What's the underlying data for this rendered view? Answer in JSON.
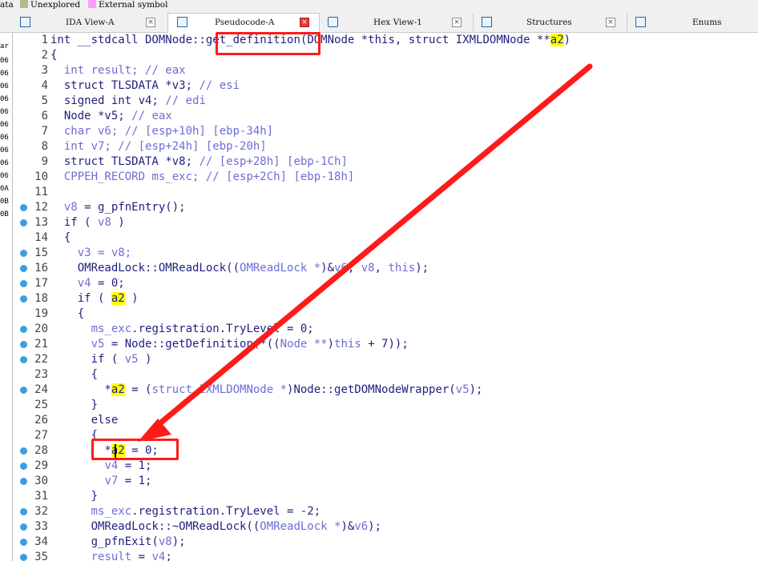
{
  "legend": [
    {
      "label": "ata",
      "color": ""
    },
    {
      "label": "Unexplored",
      "color": "#b7b78a"
    },
    {
      "label": "External symbol",
      "color": "#ff9cff"
    }
  ],
  "tabs": [
    {
      "label": "IDA View-A",
      "icon": "ida-view-icon",
      "active": false
    },
    {
      "label": "Pseudocode-A",
      "icon": "pseudocode-icon",
      "active": true
    },
    {
      "label": "Hex View-1",
      "icon": "hex-view-icon",
      "active": false
    },
    {
      "label": "Structures",
      "icon": "structures-icon",
      "active": false
    },
    {
      "label": "Enums",
      "icon": "enums-icon",
      "active": false
    }
  ],
  "left_panel": [
    "ar",
    "06",
    "06",
    "06",
    "06",
    "06",
    "06",
    "06",
    "06",
    "06",
    "06",
    "0A",
    "0B",
    "0B"
  ],
  "code_lines": [
    {
      "n": "1",
      "dot": false,
      "tokens": [
        [
          "k",
          "int __stdcall DOMNode::"
        ],
        [
          "i",
          "get_definition"
        ],
        [
          "k",
          "(DOMNode *this, struct IXMLDOMNode **"
        ],
        [
          "h",
          "a2"
        ],
        [
          "k",
          ")"
        ]
      ]
    },
    {
      "n": "2",
      "dot": false,
      "tokens": [
        [
          "k",
          "{"
        ]
      ]
    },
    {
      "n": "3",
      "dot": false,
      "tokens": [
        [
          "k",
          "  "
        ],
        [
          "v",
          "int result; // eax"
        ]
      ]
    },
    {
      "n": "4",
      "dot": false,
      "tokens": [
        [
          "k",
          "  struct TLSDATA *v3; "
        ],
        [
          "c",
          "// esi"
        ]
      ]
    },
    {
      "n": "5",
      "dot": false,
      "tokens": [
        [
          "k",
          "  signed int v4; "
        ],
        [
          "c",
          "// edi"
        ]
      ]
    },
    {
      "n": "6",
      "dot": false,
      "tokens": [
        [
          "k",
          "  Node *v5; "
        ],
        [
          "c",
          "// eax"
        ]
      ]
    },
    {
      "n": "7",
      "dot": false,
      "tokens": [
        [
          "k",
          "  "
        ],
        [
          "v",
          "char v6; "
        ],
        [
          "c",
          "// [esp+10h] [ebp-34h]"
        ]
      ]
    },
    {
      "n": "8",
      "dot": false,
      "tokens": [
        [
          "k",
          "  "
        ],
        [
          "v",
          "int v7; "
        ],
        [
          "c",
          "// [esp+24h] [ebp-20h]"
        ]
      ]
    },
    {
      "n": "9",
      "dot": false,
      "tokens": [
        [
          "k",
          "  struct TLSDATA *v8; "
        ],
        [
          "c",
          "// [esp+28h] [ebp-1Ch]"
        ]
      ]
    },
    {
      "n": "10",
      "dot": false,
      "tokens": [
        [
          "k",
          "  "
        ],
        [
          "v",
          "CPPEH_RECORD ms_exc; "
        ],
        [
          "c",
          "// [esp+2Ch] [ebp-18h]"
        ]
      ]
    },
    {
      "n": "11",
      "dot": false,
      "tokens": []
    },
    {
      "n": "12",
      "dot": true,
      "tokens": [
        [
          "k",
          "  "
        ],
        [
          "v",
          "v8"
        ],
        [
          "k",
          " = g_pfnEntry();"
        ]
      ]
    },
    {
      "n": "13",
      "dot": true,
      "tokens": [
        [
          "k",
          "  if ( "
        ],
        [
          "v",
          "v8"
        ],
        [
          "k",
          " )"
        ]
      ]
    },
    {
      "n": "14",
      "dot": false,
      "tokens": [
        [
          "k",
          "  {"
        ]
      ]
    },
    {
      "n": "15",
      "dot": true,
      "tokens": [
        [
          "k",
          "    "
        ],
        [
          "v",
          "v3 = v8;"
        ]
      ]
    },
    {
      "n": "16",
      "dot": true,
      "tokens": [
        [
          "k",
          "    OMReadLock::OMReadLock(("
        ],
        [
          "v",
          "OMReadLock *"
        ],
        [
          "k",
          ")&"
        ],
        [
          "v",
          "v6"
        ],
        [
          "k",
          ", "
        ],
        [
          "v",
          "v8"
        ],
        [
          "k",
          ", "
        ],
        [
          "v",
          "this"
        ],
        [
          "k",
          ");"
        ]
      ]
    },
    {
      "n": "17",
      "dot": true,
      "tokens": [
        [
          "k",
          "    "
        ],
        [
          "v",
          "v4"
        ],
        [
          "k",
          " = 0;"
        ]
      ]
    },
    {
      "n": "18",
      "dot": true,
      "tokens": [
        [
          "k",
          "    if ( "
        ],
        [
          "h",
          "a2"
        ],
        [
          "k",
          " )"
        ]
      ]
    },
    {
      "n": "19",
      "dot": false,
      "tokens": [
        [
          "k",
          "    {"
        ]
      ]
    },
    {
      "n": "20",
      "dot": true,
      "tokens": [
        [
          "k",
          "      "
        ],
        [
          "v",
          "ms_exc"
        ],
        [
          "k",
          ".registration.TryLevel = 0;"
        ]
      ]
    },
    {
      "n": "21",
      "dot": true,
      "tokens": [
        [
          "k",
          "      "
        ],
        [
          "v",
          "v5"
        ],
        [
          "k",
          " = Node::getDefinition(*(("
        ],
        [
          "v",
          "Node **"
        ],
        [
          "k",
          ")"
        ],
        [
          "v",
          "this"
        ],
        [
          "k",
          " + 7));"
        ]
      ]
    },
    {
      "n": "22",
      "dot": true,
      "tokens": [
        [
          "k",
          "      if ( "
        ],
        [
          "v",
          "v5"
        ],
        [
          "k",
          " )"
        ]
      ]
    },
    {
      "n": "23",
      "dot": false,
      "tokens": [
        [
          "k",
          "      {"
        ]
      ]
    },
    {
      "n": "24",
      "dot": true,
      "tokens": [
        [
          "k",
          "        *"
        ],
        [
          "h",
          "a2"
        ],
        [
          "k",
          " = ("
        ],
        [
          "v",
          "struct IXMLDOMNode *"
        ],
        [
          "k",
          ")Node::getDOMNodeWrapper("
        ],
        [
          "v",
          "v5"
        ],
        [
          "k",
          ");"
        ]
      ]
    },
    {
      "n": "25",
      "dot": false,
      "tokens": [
        [
          "k",
          "      }"
        ]
      ]
    },
    {
      "n": "26",
      "dot": false,
      "tokens": [
        [
          "k",
          "      else"
        ]
      ]
    },
    {
      "n": "27",
      "dot": false,
      "tokens": [
        [
          "k",
          "      {"
        ]
      ]
    },
    {
      "n": "28",
      "dot": true,
      "tokens": [
        [
          "k",
          "        *"
        ],
        [
          "h",
          "a2"
        ],
        [
          "k",
          " = 0;"
        ]
      ]
    },
    {
      "n": "29",
      "dot": true,
      "tokens": [
        [
          "k",
          "        "
        ],
        [
          "v",
          "v4"
        ],
        [
          "k",
          " = 1;"
        ]
      ]
    },
    {
      "n": "30",
      "dot": true,
      "tokens": [
        [
          "k",
          "        "
        ],
        [
          "v",
          "v7"
        ],
        [
          "k",
          " = 1;"
        ]
      ]
    },
    {
      "n": "31",
      "dot": false,
      "tokens": [
        [
          "k",
          "      }"
        ]
      ]
    },
    {
      "n": "32",
      "dot": true,
      "tokens": [
        [
          "k",
          "      "
        ],
        [
          "v",
          "ms_exc"
        ],
        [
          "k",
          ".registration.TryLevel = -2;"
        ]
      ]
    },
    {
      "n": "33",
      "dot": true,
      "tokens": [
        [
          "k",
          "      OMReadLock::~OMReadLock(("
        ],
        [
          "v",
          "OMReadLock *"
        ],
        [
          "k",
          ")&"
        ],
        [
          "v",
          "v6"
        ],
        [
          "k",
          ");"
        ]
      ]
    },
    {
      "n": "34",
      "dot": true,
      "tokens": [
        [
          "k",
          "      g_pfnExit("
        ],
        [
          "v",
          "v8"
        ],
        [
          "k",
          ");"
        ]
      ]
    },
    {
      "n": "35",
      "dot": true,
      "tokens": [
        [
          "k",
          "      "
        ],
        [
          "v",
          "result"
        ],
        [
          "k",
          " = "
        ],
        [
          "v",
          "v4"
        ],
        [
          "k",
          ";"
        ]
      ]
    }
  ],
  "colors": {
    "keyword": "#1f1f80",
    "variable": "#6d6dd6",
    "highlight": "#ffff00",
    "breakpoint_dot": "#3c9ee0",
    "annotation": "#ff1a1a"
  }
}
